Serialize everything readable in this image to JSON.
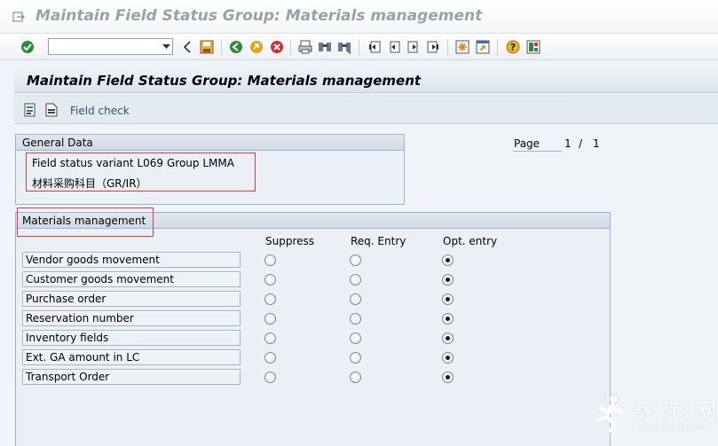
{
  "window": {
    "title": "Maintain Field Status Group: Materials management"
  },
  "system_toolbar": {
    "command_field_value": "",
    "icons": [
      "enter-check-icon",
      "back-arrow-icon",
      "save-icon",
      "back-icon",
      "exit-icon",
      "cancel-icon",
      "print-icon",
      "find-icon",
      "find-next-icon",
      "first-page-icon",
      "previous-page-icon",
      "next-page-icon",
      "last-page-icon",
      "create-session-icon",
      "shortcut-icon",
      "help-icon",
      "layout-menu-icon"
    ]
  },
  "screen": {
    "title": "Maintain Field Status Group: Materials management"
  },
  "app_toolbar": {
    "field_check_label": "Field check"
  },
  "paging": {
    "label": "Page",
    "current": "1",
    "separator": "/",
    "total": "1"
  },
  "general_data": {
    "header": "General Data",
    "variant_text": "Field status variant L069",
    "group_text": "Group LMMA",
    "description": "材料采购科目（GR/IR）"
  },
  "materials_management": {
    "header": "Materials management",
    "columns": [
      "Suppress",
      "Req. Entry",
      "Opt. entry"
    ],
    "rows": [
      {
        "label": "Vendor goods movement",
        "selected": "Opt. entry"
      },
      {
        "label": "Customer goods movement",
        "selected": "Opt. entry"
      },
      {
        "label": "Purchase order",
        "selected": "Opt. entry"
      },
      {
        "label": "Reservation number",
        "selected": "Opt. entry"
      },
      {
        "label": "Inventory fields",
        "selected": "Opt. entry"
      },
      {
        "label": "Ext. GA amount in LC",
        "selected": "Opt. entry"
      },
      {
        "label": "Transport Order",
        "selected": "Opt. entry"
      }
    ]
  },
  "watermark": {
    "text": "赛 跑 网",
    "url": "www.91sap.com"
  },
  "colors": {
    "highlight_box": "#e23b3b",
    "title_gray": "#9aa1aa",
    "link_blue": "#2f4f7a"
  }
}
